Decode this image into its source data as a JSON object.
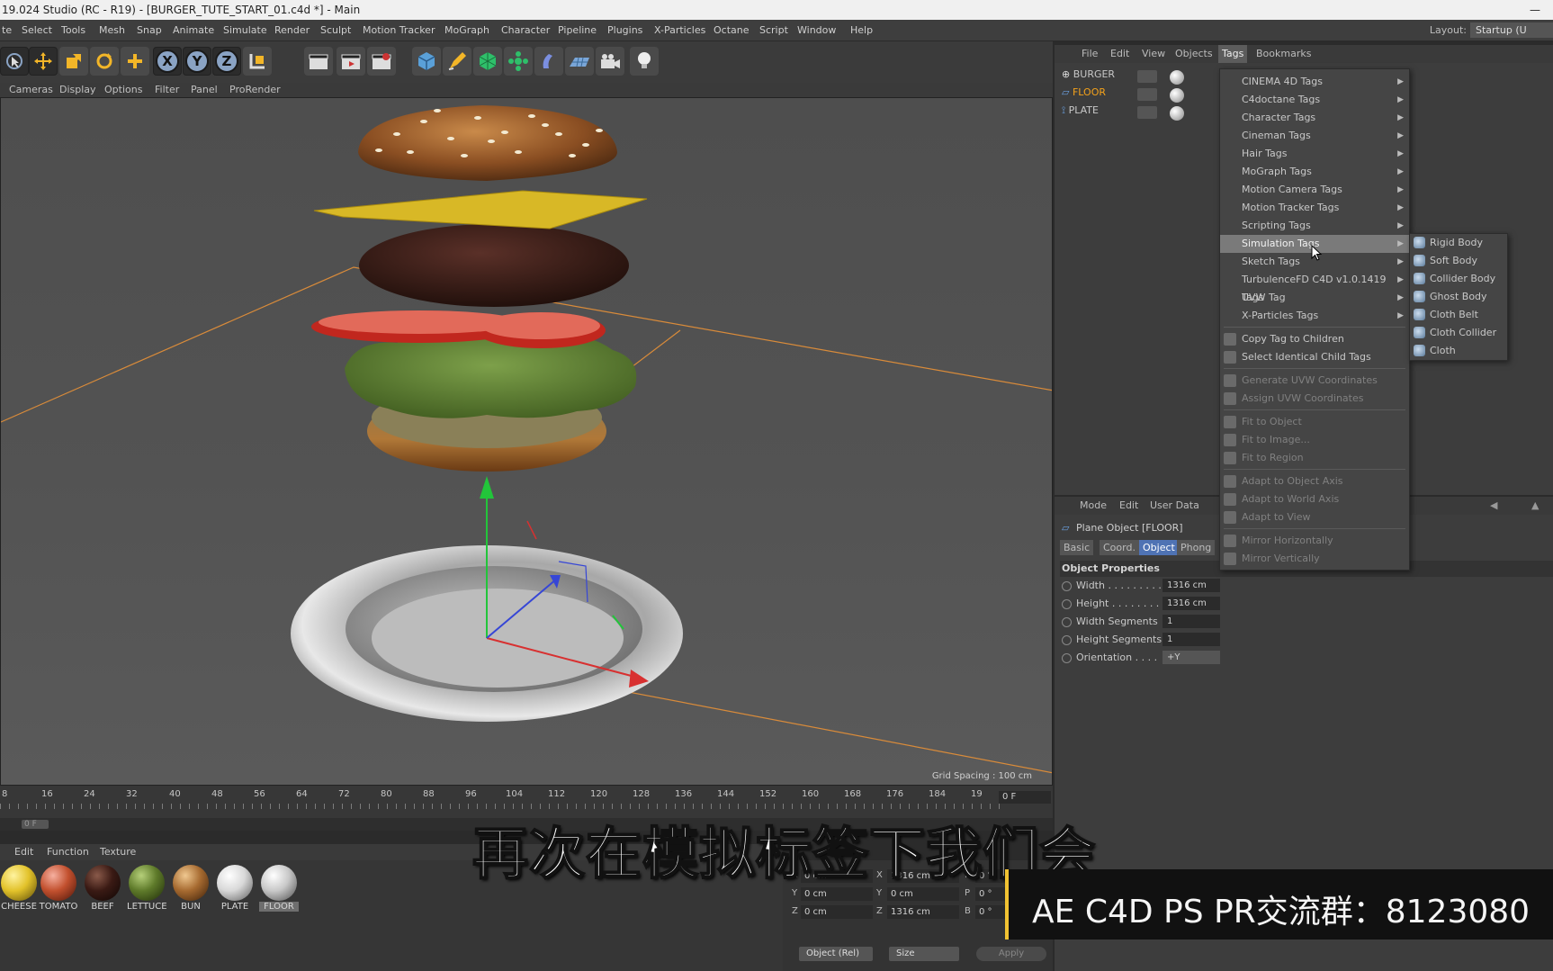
{
  "window": {
    "title": "19.024 Studio (RC - R19) - [BURGER_TUTE_START_01.c4d *] - Main",
    "minimize": "—"
  },
  "menubar": {
    "items": [
      "te",
      "Select",
      "Tools",
      "Mesh",
      "Snap",
      "Animate",
      "Simulate",
      "Render",
      "Sculpt",
      "Motion Tracker",
      "MoGraph",
      "Character",
      "Pipeline",
      "Plugins",
      "X-Particles",
      "Octane",
      "Script",
      "Window",
      "Help"
    ],
    "layout_label": "Layout:",
    "layout_value": "Startup (U"
  },
  "toolbar": {
    "axis_x": "X",
    "axis_y": "Y",
    "axis_z": "Z"
  },
  "viewport": {
    "menu": [
      "Cameras",
      "Display",
      "Options",
      "Filter",
      "Panel",
      "ProRender"
    ],
    "grid_spacing": "Grid Spacing : 100 cm"
  },
  "timeline": {
    "ticks": [
      "8",
      "16",
      "24",
      "32",
      "40",
      "48",
      "56",
      "64",
      "72",
      "80",
      "88",
      "96",
      "104",
      "112",
      "120",
      "128",
      "136",
      "144",
      "152",
      "160",
      "168",
      "176",
      "184",
      "19"
    ],
    "frame": "0 F",
    "scrub_frame": "0 F"
  },
  "materials": {
    "menu": [
      "Edit",
      "Function",
      "Texture"
    ],
    "items": [
      {
        "label": "CHEESE",
        "color": "#e2c22a"
      },
      {
        "label": "TOMATO",
        "color": "#c2502e"
      },
      {
        "label": "BEEF",
        "color": "#3a1a14"
      },
      {
        "label": "LETTUCE",
        "color": "#5e7a2a"
      },
      {
        "label": "BUN",
        "color": "#a66a30"
      },
      {
        "label": "PLATE",
        "color": "#d8d8d8"
      },
      {
        "label": "FLOOR",
        "color": "#c8c8c8"
      }
    ]
  },
  "coords": {
    "rows": [
      {
        "ax1": "X",
        "v1": "0 cm",
        "ax2": "X",
        "v2": "1316 cm",
        "ax3": "H",
        "v3": "0 °"
      },
      {
        "ax1": "Y",
        "v1": "0 cm",
        "ax2": "Y",
        "v2": "0 cm",
        "ax3": "P",
        "v3": "0 °"
      },
      {
        "ax1": "Z",
        "v1": "0 cm",
        "ax2": "Z",
        "v2": "1316 cm",
        "ax3": "B",
        "v3": "0 °"
      }
    ],
    "mode": "Object (Rel)",
    "size": "Size",
    "apply": "Apply"
  },
  "object_manager": {
    "menu": [
      "File",
      "Edit",
      "View",
      "Objects",
      "Tags",
      "Bookmarks"
    ],
    "objects": [
      {
        "name": "BURGER",
        "selected": false
      },
      {
        "name": "FLOOR",
        "selected": true
      },
      {
        "name": "PLATE",
        "selected": false
      }
    ]
  },
  "tags_menu": {
    "items": [
      {
        "label": "CINEMA 4D Tags",
        "arrow": "▶"
      },
      {
        "label": "C4doctane Tags",
        "arrow": "▶"
      },
      {
        "label": "Character Tags",
        "arrow": "▶"
      },
      {
        "label": "Cineman Tags",
        "arrow": "▶"
      },
      {
        "label": "Hair Tags",
        "arrow": "▶"
      },
      {
        "label": "MoGraph Tags",
        "arrow": "▶"
      },
      {
        "label": "Motion Camera Tags",
        "arrow": "▶"
      },
      {
        "label": "Motion Tracker Tags",
        "arrow": "▶"
      },
      {
        "label": "Scripting Tags",
        "arrow": "▶"
      },
      {
        "label": "Simulation Tags",
        "arrow": "▶"
      },
      {
        "label": "Sketch Tags",
        "arrow": "▶"
      },
      {
        "label": "TurbulenceFD C4D v1.0.1419 Tags",
        "arrow": "▶"
      },
      {
        "label": "UVW Tag",
        "arrow": "▶"
      },
      {
        "label": "X-Particles Tags",
        "arrow": "▶"
      }
    ],
    "actions": [
      "Copy Tag to Children",
      "Select Identical Child Tags"
    ],
    "disabled1": [
      "Generate UVW Coordinates",
      "Assign UVW Coordinates"
    ],
    "disabled2": [
      "Fit to Object",
      "Fit to Image...",
      "Fit to Region"
    ],
    "disabled3": [
      "Adapt to Object Axis",
      "Adapt to World Axis",
      "Adapt to View"
    ],
    "disabled4": [
      "Mirror Horizontally",
      "Mirror Vertically"
    ]
  },
  "simulation_submenu": [
    "Rigid Body",
    "Soft Body",
    "Collider Body",
    "Ghost Body",
    "Cloth Belt",
    "Cloth Collider",
    "Cloth"
  ],
  "attributes": {
    "menu": [
      "Mode",
      "Edit",
      "User Data"
    ],
    "title": "Plane Object [FLOOR]",
    "tabs": [
      "Basic",
      "Coord.",
      "Object",
      "Phong"
    ],
    "section": "Object Properties",
    "props": [
      {
        "label": "Width . . . . . . . . .",
        "value": "1316 cm"
      },
      {
        "label": "Height . . . . . . . .",
        "value": "1316 cm"
      },
      {
        "label": "Width Segments",
        "value": "1"
      },
      {
        "label": "Height Segments",
        "value": "1"
      },
      {
        "label": "Orientation . . . .",
        "value": "+Y"
      }
    ]
  },
  "overlay": {
    "subtitle": "再次在模拟标签下我们会",
    "banner": "AE C4D PS PR交流群：8123080"
  }
}
